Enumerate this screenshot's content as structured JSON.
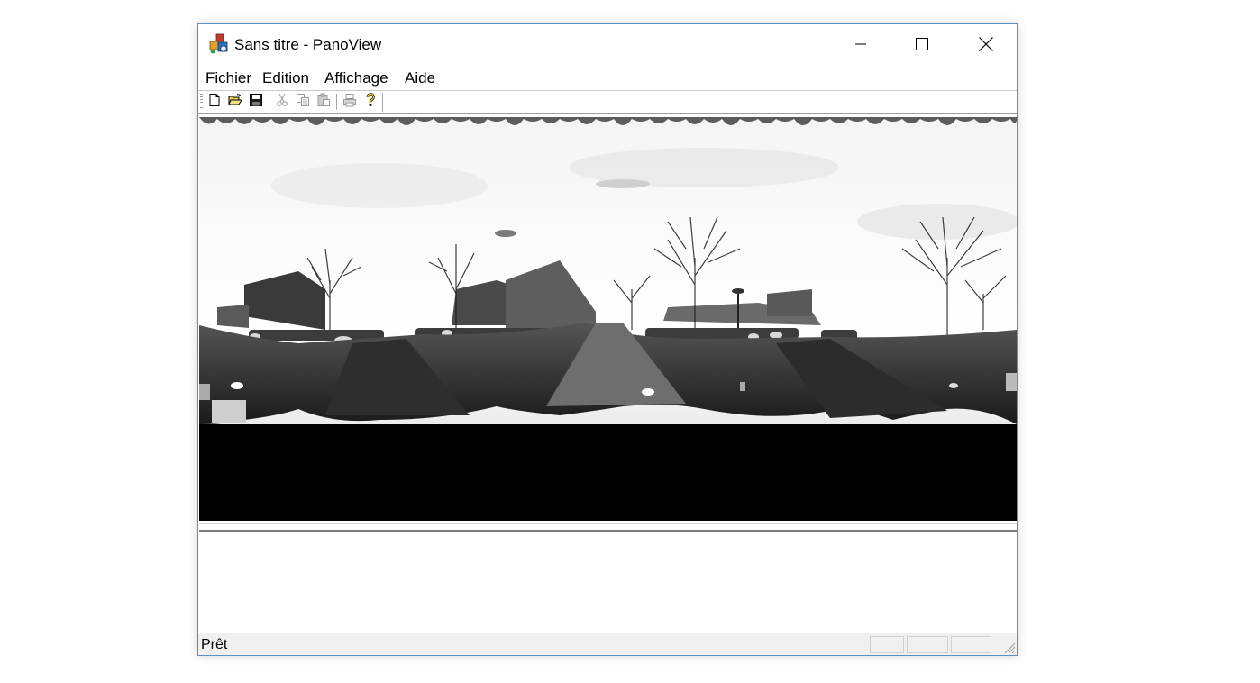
{
  "window": {
    "title": "Sans titre - PanoView",
    "app_icon": "panoview-app-icon",
    "controls": [
      "minimize-icon",
      "maximize-icon",
      "close-icon"
    ]
  },
  "menu": {
    "items": [
      {
        "label": "Fichier"
      },
      {
        "label": "Edition"
      },
      {
        "label": "Affichage"
      },
      {
        "label": "Aide"
      }
    ]
  },
  "toolbar": {
    "buttons": [
      {
        "icon": "new-document-icon",
        "enabled": true
      },
      {
        "icon": "open-folder-icon",
        "enabled": true
      },
      {
        "icon": "save-icon",
        "enabled": true
      },
      {
        "icon": "cut-icon",
        "enabled": false
      },
      {
        "icon": "copy-icon",
        "enabled": false
      },
      {
        "icon": "paste-icon",
        "enabled": false
      },
      {
        "icon": "print-icon",
        "enabled": false
      },
      {
        "icon": "help-icon",
        "enabled": true
      }
    ]
  },
  "view": {
    "content": "grayscale panoramic photograph"
  },
  "status": {
    "text": "Prêt",
    "panes": [
      "",
      "",
      ""
    ]
  },
  "colors": {
    "window_border": "#5b8fc8",
    "statusbar_bg": "#f0f0f0",
    "view_bg": "#000000"
  }
}
